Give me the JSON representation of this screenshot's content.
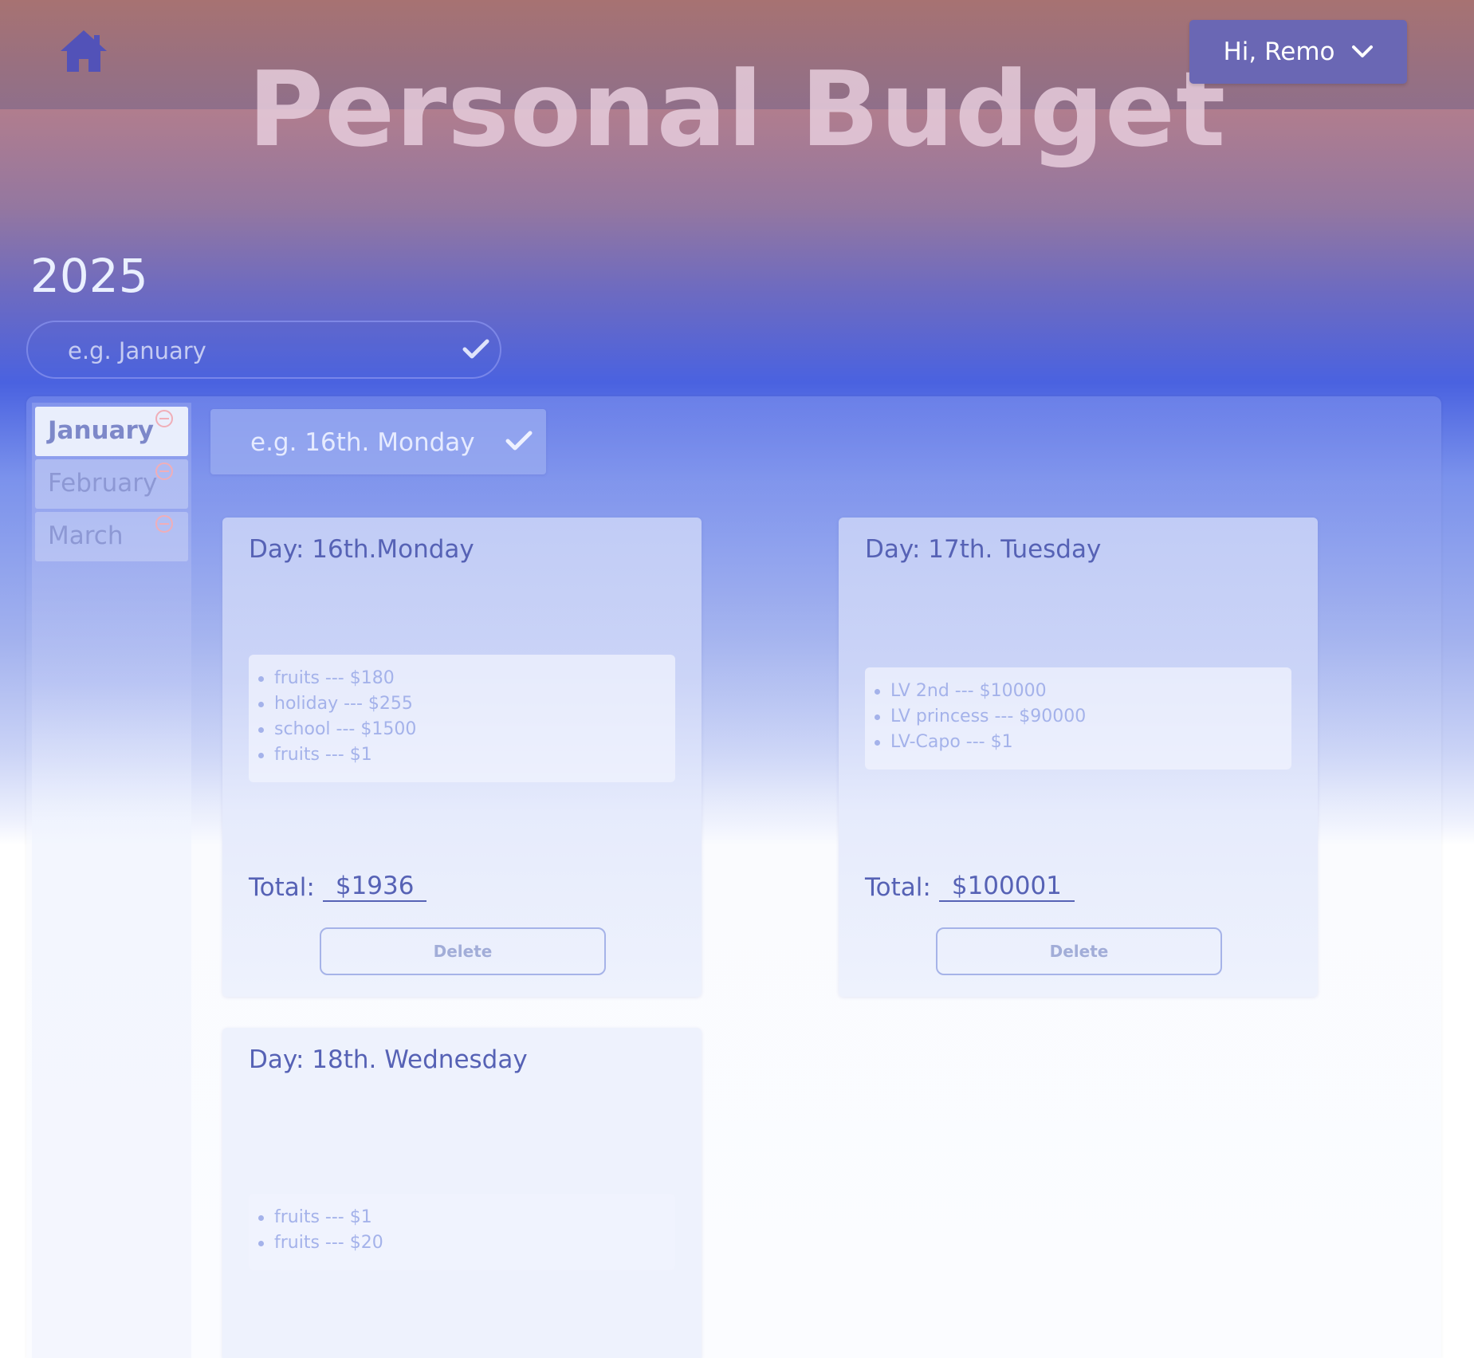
{
  "header": {
    "title": "Personal Budget",
    "user_menu_label": "Hi, Remo",
    "home_icon": "home-icon",
    "chevron_icon": "chevron-down-icon"
  },
  "year": "2025",
  "month_input": {
    "placeholder": "e.g. January",
    "value": ""
  },
  "months": [
    {
      "label": "January",
      "active": true
    },
    {
      "label": "February",
      "active": false
    },
    {
      "label": "March",
      "active": false
    }
  ],
  "day_input": {
    "placeholder": "e.g. 16th. Monday",
    "value": ""
  },
  "days": [
    {
      "title": "Day: 16th.Monday",
      "items": [
        "fruits --- $180",
        "holiday --- $255",
        "school --- $1500",
        "fruits --- $1"
      ],
      "total_label": "Total:",
      "total_value": "$1936",
      "delete_label": "Delete"
    },
    {
      "title": "Day: 17th. Tuesday",
      "items": [
        "LV 2nd --- $10000",
        "LV princess --- $90000",
        "LV-Capo --- $1"
      ],
      "total_label": "Total:",
      "total_value": "$100001",
      "delete_label": "Delete"
    },
    {
      "title": "Day: 18th. Wednesday",
      "items": [
        "fruits --- $1",
        "fruits --- $20"
      ]
    }
  ],
  "colors": {
    "accent": "#6a67b4",
    "text_primary": "#5662b5",
    "item_text": "#a4b2ea",
    "remove_icon": "#f0aeb8"
  }
}
